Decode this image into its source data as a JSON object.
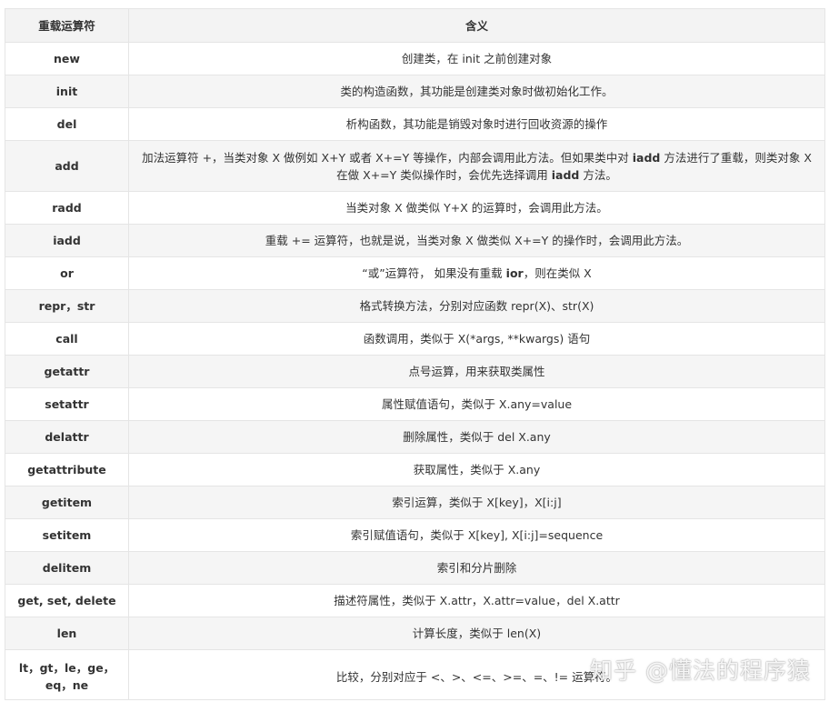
{
  "header": {
    "col_operator": "重载运算符",
    "col_meaning": "含义"
  },
  "rows": [
    {
      "op": "new",
      "desc": "创建类，在 init 之前创建对象"
    },
    {
      "op": "init",
      "desc": "类的构造函数，其功能是创建类对象时做初始化工作。"
    },
    {
      "op": "del",
      "desc": "析构函数，其功能是销毁对象时进行回收资源的操作"
    },
    {
      "op": "add",
      "desc_1": "加法运算符 +，当类对象 X 做例如 X+Y 或者 X+=Y 等操作，内部会调用此方法。但如果类中对 ",
      "desc_b1": "iadd",
      "desc_2": " 方法进行了重载，则类对象 X 在做 X+=Y 类似操作时，会优先选择调用 ",
      "desc_b2": "iadd",
      "desc_3": " 方法。"
    },
    {
      "op": "radd",
      "desc": "当类对象 X 做类似 Y+X 的运算时，会调用此方法。"
    },
    {
      "op": "iadd",
      "desc": "重载 += 运算符，也就是说，当类对象 X 做类似 X+=Y 的操作时，会调用此方法。"
    },
    {
      "op": "or",
      "desc_1": "“或”运算符， 如果没有重载 ",
      "desc_b1": "ior",
      "desc_2": "，则在类似 X"
    },
    {
      "op": "repr，str",
      "desc": "格式转换方法，分别对应函数 repr(X)、str(X)"
    },
    {
      "op": "call",
      "desc": "函数调用，类似于 X(*args, **kwargs) 语句"
    },
    {
      "op": "getattr",
      "desc": "点号运算，用来获取类属性"
    },
    {
      "op": "setattr",
      "desc": "属性赋值语句，类似于 X.any=value"
    },
    {
      "op": "delattr",
      "desc": "删除属性，类似于 del X.any"
    },
    {
      "op": "getattribute",
      "desc": "获取属性，类似于 X.any"
    },
    {
      "op": "getitem",
      "desc": "索引运算，类似于 X[key]，X[i:j]"
    },
    {
      "op": "setitem",
      "desc": "索引赋值语句，类似于 X[key], X[i:j]=sequence"
    },
    {
      "op": "delitem",
      "desc": "索引和分片删除"
    },
    {
      "op": "get, set, delete",
      "desc": "描述符属性，类似于 X.attr，X.attr=value，del X.attr"
    },
    {
      "op": "len",
      "desc": "计算长度，类似于 len(X)"
    },
    {
      "op_1": "lt，gt，le，ge，",
      "op_2": "eq，ne",
      "desc": "比较，分别对应于 <、>、<=、>=、=、!= 运算符。"
    }
  ],
  "watermark": {
    "text": "知乎 @懂法的程序猿"
  }
}
